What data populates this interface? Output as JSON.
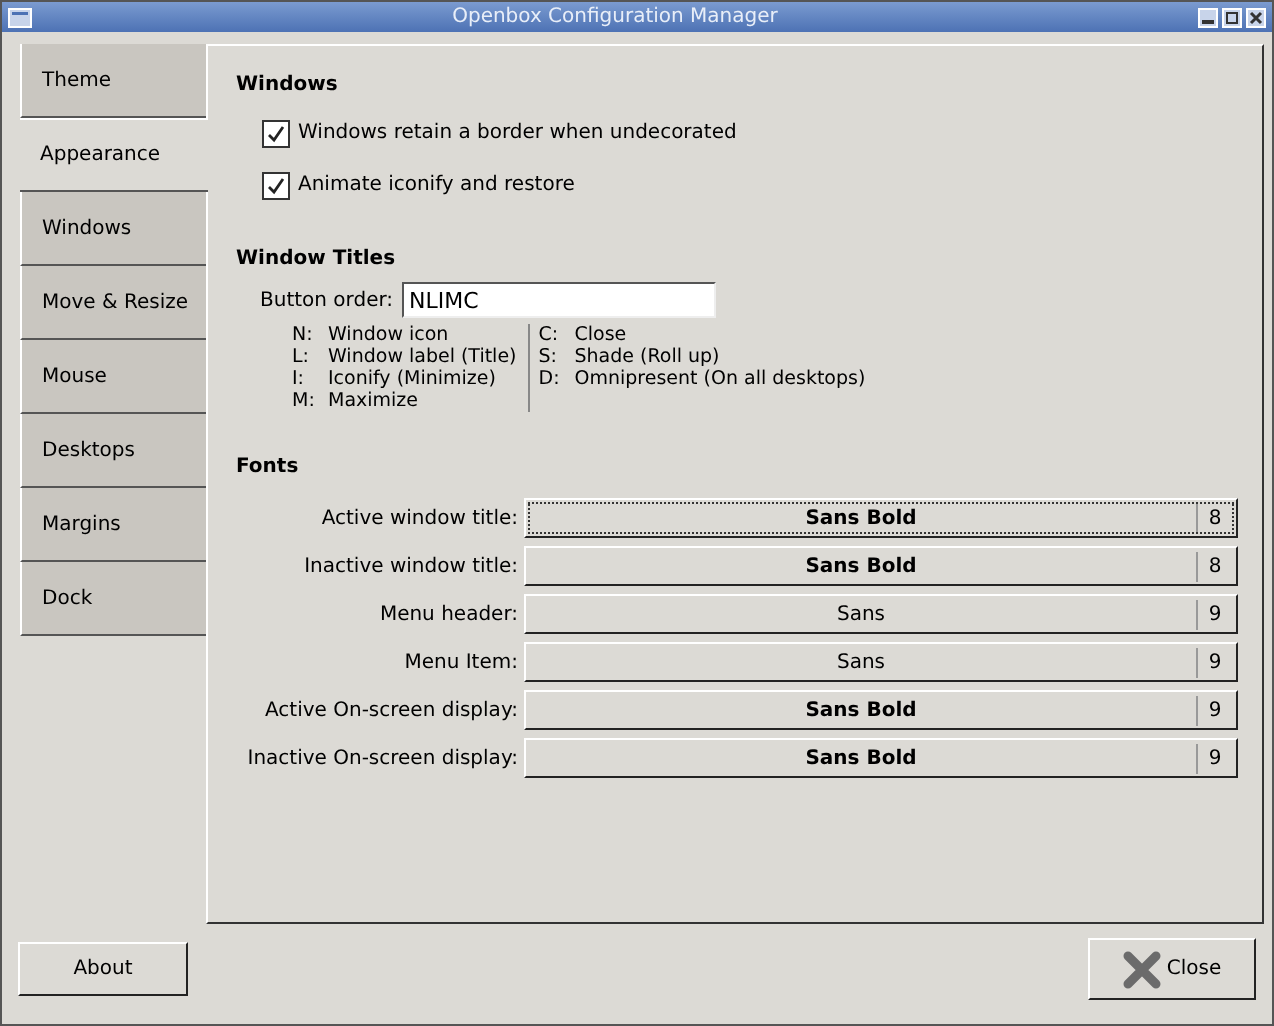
{
  "window": {
    "title": "Openbox Configuration Manager"
  },
  "tabs": [
    {
      "label": "Theme",
      "selected": false
    },
    {
      "label": "Appearance",
      "selected": true
    },
    {
      "label": "Windows",
      "selected": false
    },
    {
      "label": "Move & Resize",
      "selected": false
    },
    {
      "label": "Mouse",
      "selected": false
    },
    {
      "label": "Desktops",
      "selected": false
    },
    {
      "label": "Margins",
      "selected": false
    },
    {
      "label": "Dock",
      "selected": false
    }
  ],
  "windows_section": {
    "heading": "Windows",
    "options": [
      {
        "label": "Windows retain a border when undecorated",
        "checked": true
      },
      {
        "label": "Animate iconify and restore",
        "checked": true
      }
    ]
  },
  "window_titles": {
    "heading": "Window Titles",
    "button_order_label": "Button order:",
    "button_order_value": "NLIMC",
    "legend_left": [
      {
        "key": "N:",
        "meaning": "Window icon"
      },
      {
        "key": "L:",
        "meaning": "Window label (Title)"
      },
      {
        "key": "I:",
        "meaning": "Iconify (Minimize)"
      },
      {
        "key": "M:",
        "meaning": "Maximize"
      }
    ],
    "legend_right": [
      {
        "key": "C:",
        "meaning": "Close"
      },
      {
        "key": "S:",
        "meaning": "Shade (Roll up)"
      },
      {
        "key": "D:",
        "meaning": "Omnipresent (On all desktops)"
      }
    ]
  },
  "fonts": {
    "heading": "Fonts",
    "rows": [
      {
        "label": "Active window title:",
        "font": "Sans Bold",
        "bold": true,
        "size": "8",
        "selected": true
      },
      {
        "label": "Inactive window title:",
        "font": "Sans Bold",
        "bold": true,
        "size": "8",
        "selected": false
      },
      {
        "label": "Menu header:",
        "font": "Sans",
        "bold": false,
        "size": "9",
        "selected": false
      },
      {
        "label": "Menu Item:",
        "font": "Sans",
        "bold": false,
        "size": "9",
        "selected": false
      },
      {
        "label": "Active On-screen display:",
        "font": "Sans Bold",
        "bold": true,
        "size": "9",
        "selected": false
      },
      {
        "label": "Inactive On-screen display:",
        "font": "Sans Bold",
        "bold": true,
        "size": "9",
        "selected": false
      }
    ]
  },
  "buttons": {
    "about": "About",
    "close": "Close"
  }
}
